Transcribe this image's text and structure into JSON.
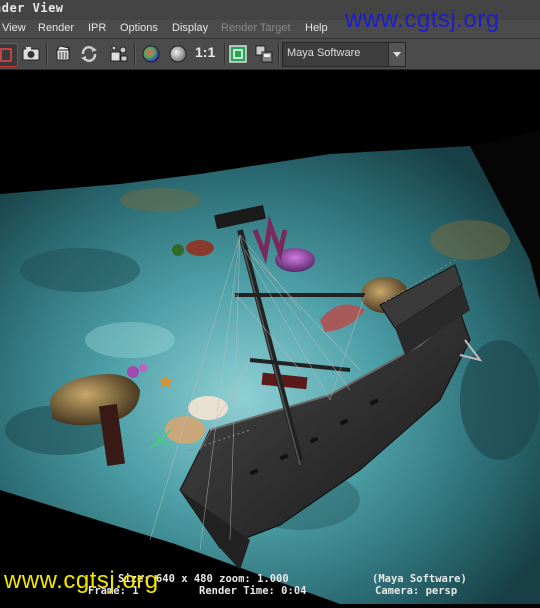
{
  "window": {
    "title": "nder View"
  },
  "menubar": {
    "items": [
      {
        "label": "View",
        "enabled": true
      },
      {
        "label": "Render",
        "enabled": true
      },
      {
        "label": "IPR",
        "enabled": true
      },
      {
        "label": "Options",
        "enabled": true
      },
      {
        "label": "Display",
        "enabled": true
      },
      {
        "label": "Render Target",
        "enabled": false
      },
      {
        "label": "Help",
        "enabled": true
      }
    ]
  },
  "toolbar": {
    "one_to_one_label": "1:1",
    "renderer": {
      "selected": "Maya Software"
    }
  },
  "watermarks": {
    "top": "www.cgtsj.org",
    "bottom": "www.cgtsj.org"
  },
  "render_info": {
    "size_text": "Size: 640 x 480 zoom: 1.000",
    "renderer_text": "(Maya Software)",
    "frame_text": "Frame: 1",
    "render_time_text": "Render Time: 0:04",
    "camera_text": "Camera: persp"
  },
  "colors": {
    "watermark_top": "#1e1ec8",
    "watermark_bottom": "#f2e600",
    "ui_bg": "#4b4b4b"
  },
  "icons": [
    "region-render-icon",
    "snapshot-camera-icon",
    "render-clapper-icon",
    "refresh-ipr-icon",
    "render-settings-icon",
    "rgb-channels-icon",
    "alpha-channel-icon",
    "display-frame-icon",
    "keep-image-icon"
  ]
}
